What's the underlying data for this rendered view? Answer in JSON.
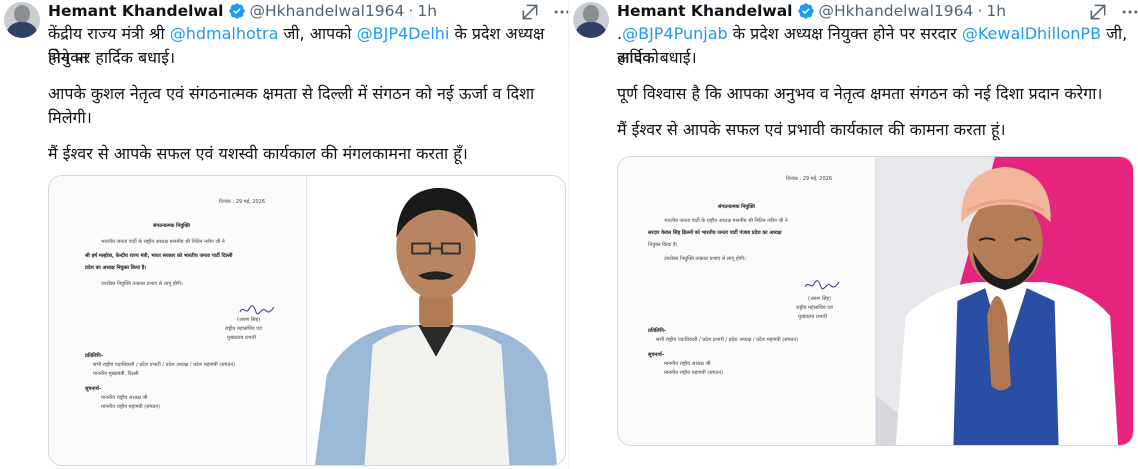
{
  "tweets": [
    {
      "author_name": "Hemant Khandelwal",
      "handle": "@Hkhandelwal1964",
      "separator": "·",
      "time": "1h",
      "line1_pre": "केंद्रीय राज्य मंत्री श्री ",
      "line1_mention": "@hdmalhotra",
      "line1_mid": " जी, आपको ",
      "line1_mention2": "@BJP4Delhi",
      "line1_post": " के प्रदेश अध्यक्ष नियुक्त",
      "line2": "होने पर हार्दिक बधाई।",
      "para2_line1": "आपके कुशल नेतृत्व एवं संगठनात्मक क्षमता से दिल्ली में संगठन को नई ऊर्जा व दिशा",
      "para2_line2": "मिलेगी।",
      "para3": "मैं ईश्वर से आपके सफल एवं यशस्वी कार्यकाल की मंगलकामना करता हूँ।",
      "letter": {
        "date": "दिनांक : 29 मई, 2026",
        "subject": "संगठनात्मक नियुक्ति",
        "body1": "भारतीय जनता पार्टी के राष्ट्रीय अध्यक्ष माननीय श्री नितिन नवीन जी ने",
        "body2": "श्री हर्ष मल्होत्रा, केन्द्रीय राज्य मंत्री, भारत सरकार को भारतीय जनता पार्टी दिल्ली",
        "body3": "प्रदेश का अध्यक्ष नियुक्त किया है।",
        "body4": "उपरोक्त नियुक्ति तत्काल प्रभाव से लागू होगी।",
        "sign_name": "(अरुण सिंह)",
        "sign_title1": "राष्ट्रीय महासचिव एवं",
        "sign_title2": "मुख्यालय प्रभारी",
        "cc_head": "प्रतिलिपि–",
        "cc1": "सभी राष्ट्रीय पदाधिकारी / प्रदेश प्रभारी / प्रदेश अध्यक्ष / प्रदेश महामंत्री (संगठन)",
        "cc2": "माननीय मुख्यमंत्री, दिल्ली",
        "info_head": "सूचनार्थ–",
        "info1": "माननीय राष्ट्रीय अध्यक्ष जी",
        "info2": "माननीय राष्ट्रीय महामंत्री (संगठन)"
      }
    },
    {
      "author_name": "Hemant Khandelwal",
      "handle": "@Hkhandelwal1964",
      "separator": "·",
      "time": "1h",
      "line1_pre": ".",
      "line1_mention": "@BJP4Punjab",
      "line1_mid": " के प्रदेश अध्यक्ष नियुक्त होने पर सरदार ",
      "line1_mention2": "@KewalDhillonPB",
      "line1_post": " जी, आपको",
      "line2": "हार्दिक बधाई।",
      "para2_line1": "पूर्ण विश्वास है कि आपका अनुभव व नेतृत्व क्षमता संगठन को नई दिशा प्रदान करेगा।",
      "para3": "मैं ईश्वर से आपके सफल एवं प्रभावी कार्यकाल की कामना करता हूं।",
      "letter": {
        "date": "दिनांक : 29 मई, 2026",
        "subject": "संगठनात्मक नियुक्ति",
        "body1": "भारतीय जनता पार्टी के राष्ट्रीय अध्यक्ष माननीय श्री नितिन नवीन जी ने",
        "body2": "सरदार केवल सिंह ढिल्लों को भारतीय जनता पार्टी पंजाब प्रदेश का अध्यक्ष",
        "body3": "नियुक्त किया है।",
        "body4": "उपरोक्त नियुक्ति तत्काल प्रभाव से लागू होगी।",
        "sign_name": "(अरुण सिंह)",
        "sign_title1": "राष्ट्रीय महासचिव एवं",
        "sign_title2": "मुख्यालय प्रभारी",
        "cc_head": "प्रतिलिपि–",
        "cc1": "सभी राष्ट्रीय पदाधिकारी / प्रदेश प्रभारी / प्रदेश अध्यक्ष / प्रदेश महामंत्री (संगठन)",
        "info_head": "सूचनार्थ–",
        "info1": "माननीय राष्ट्रीय अध्यक्ष जी",
        "info2": "माननीय राष्ट्रीय महामंत्री (संगठन)"
      }
    }
  ],
  "colors": {
    "link": "#1d9bf0",
    "verified": "#1d9bf0",
    "secondary": "#536471",
    "accent_pink": "#e5247d"
  },
  "icons": [
    "grok-icon",
    "more-icon",
    "verified-badge-icon"
  ]
}
